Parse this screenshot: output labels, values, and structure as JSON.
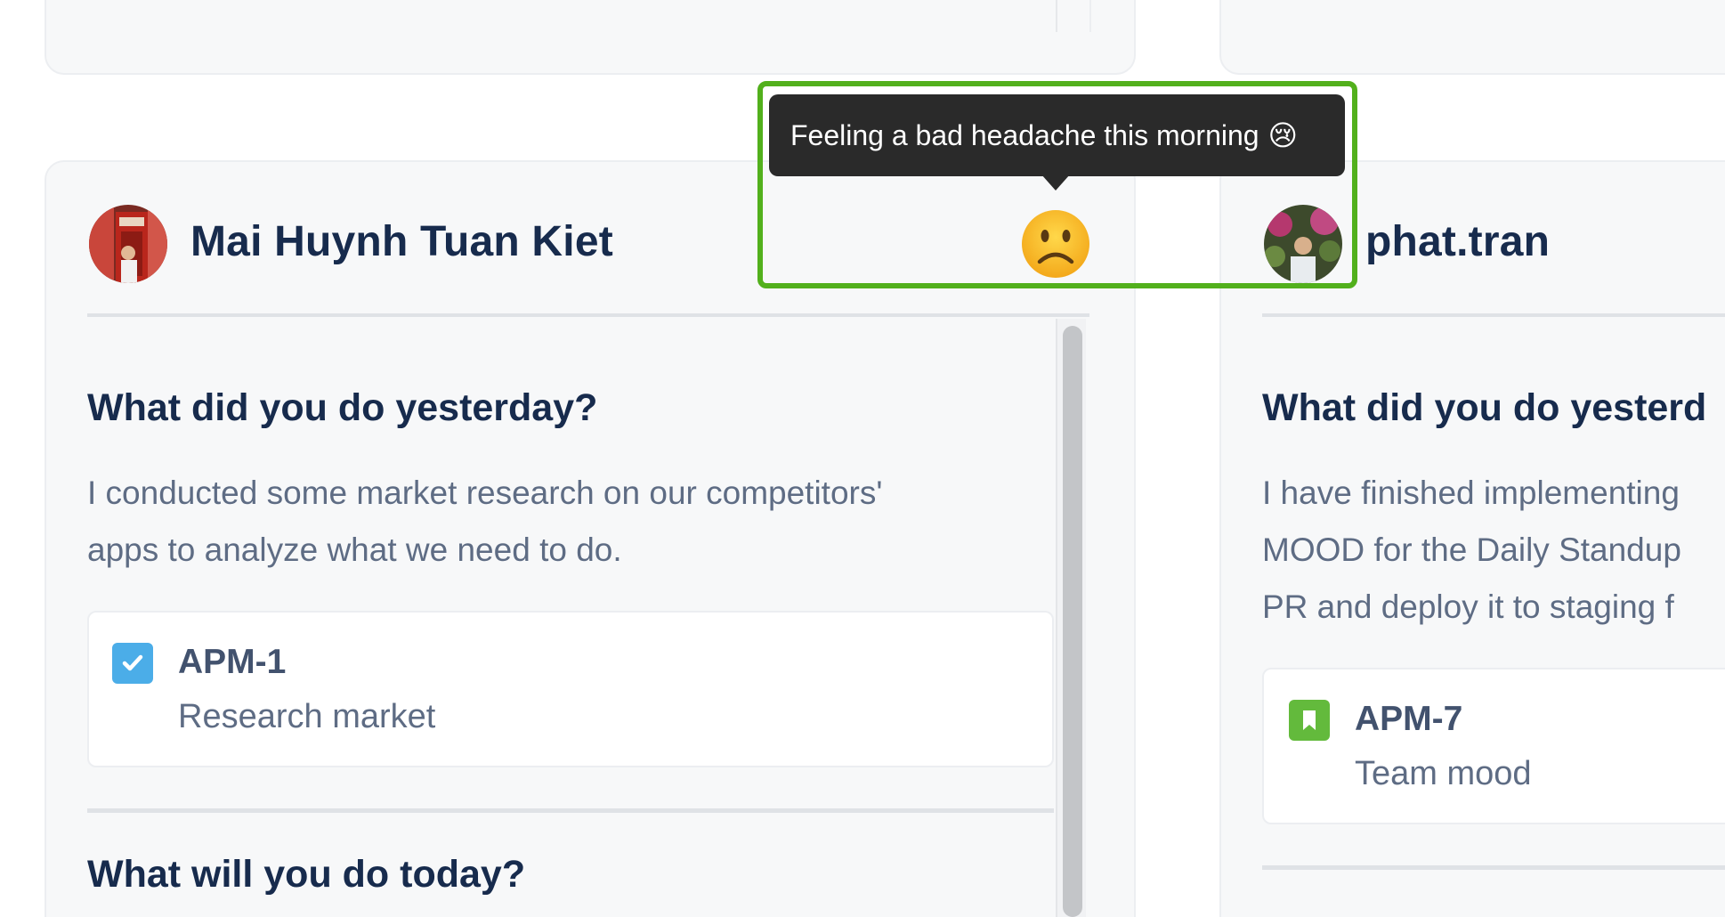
{
  "tooltip": {
    "text": "Feeling a bad headache this morning",
    "emoji": "😢"
  },
  "mood_icon": "frowning-face-icon",
  "left_card": {
    "user_name": "Mai Huynh Tuan Kiet",
    "yesterday": {
      "heading": "What did you do yesterday?",
      "body_lines": [
        "I conducted some market research on our competitors'",
        "apps to analyze what we need to do."
      ],
      "issue": {
        "key": "APM-1",
        "title": "Research market",
        "icon": "task-checkbox-icon",
        "color": "#4bade8"
      }
    },
    "today": {
      "heading": "What will you do today?"
    }
  },
  "right_card": {
    "user_name": "phat.tran",
    "yesterday": {
      "heading": "What did you do yesterd",
      "body_lines": [
        "I have finished implementing",
        "MOOD for the Daily Standup",
        "PR and deploy it to staging f"
      ],
      "issue": {
        "key": "APM-7",
        "title": "Team mood",
        "icon": "story-bookmark-icon",
        "color": "#63ba3c"
      }
    }
  },
  "colors": {
    "highlight": "#52b01c",
    "heading": "#172b4d",
    "body": "#5e6c84"
  }
}
